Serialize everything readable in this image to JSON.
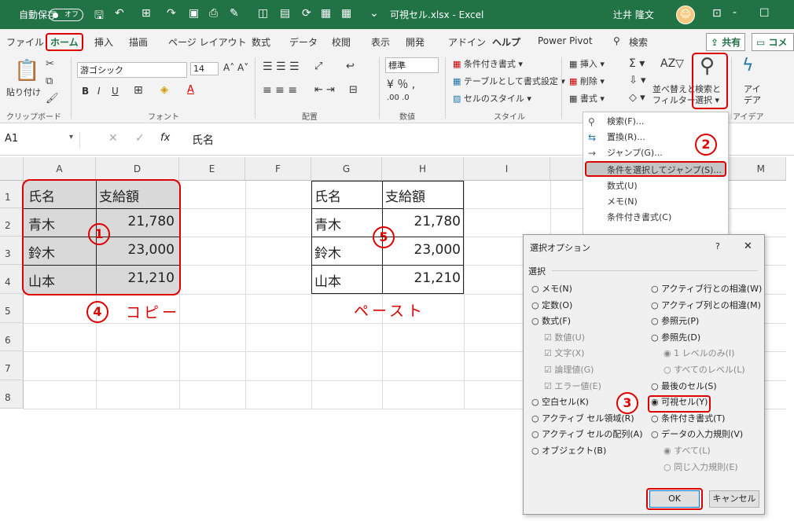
{
  "titlebar": {
    "autosave": "自動保存",
    "toggle": "オフ",
    "filename": "可視セル.xlsx",
    "app": "Excel",
    "user": "辻井 隆文",
    "dash": "-"
  },
  "tabs": [
    "ファイル",
    "ホーム",
    "挿入",
    "描画",
    "ページ レイアウト",
    "数式",
    "データ",
    "校閲",
    "表示",
    "開発",
    "アドイン",
    "ヘルプ",
    "Power Pivot"
  ],
  "search": "検索",
  "share": "共有",
  "comment": "コメ",
  "ribbon": {
    "paste": "貼り付け",
    "clipboard": "クリップボード",
    "font_name": "游ゴシック",
    "font_size": "14",
    "font_group": "フォント",
    "align_group": "配置",
    "num_format": "標準",
    "num_group": "数値",
    "cond_format": "条件付き書式",
    "table_format": "テーブルとして書式設定",
    "cell_style": "セルのスタイル",
    "style_group": "スタイル",
    "insert": "挿入",
    "delete": "削除",
    "format": "書式",
    "sort_filter": [
      "並べ替えと",
      "フィルター"
    ],
    "find_select": [
      "検索と",
      "選択"
    ],
    "ideas": [
      "アイ",
      "デア"
    ],
    "idea_group": "アイデア"
  },
  "formula": {
    "namebox": "A1",
    "fx": "fx",
    "content": "氏名"
  },
  "columns": [
    "A",
    "D",
    "E",
    "F",
    "G",
    "H",
    "I",
    "M"
  ],
  "rows": [
    "1",
    "2",
    "3",
    "4",
    "5",
    "6",
    "7",
    "8"
  ],
  "left_table": {
    "header": [
      "氏名",
      "支給額"
    ],
    "rows": [
      [
        "青木",
        "21,780"
      ],
      [
        "鈴木",
        "23,000"
      ],
      [
        "山本",
        "21,210"
      ]
    ]
  },
  "right_table": {
    "header": [
      "氏名",
      "支給額"
    ],
    "rows": [
      [
        "青木",
        "21,780"
      ],
      [
        "鈴木",
        "23,000"
      ],
      [
        "山本",
        "21,210"
      ]
    ]
  },
  "annotations": {
    "c1": "1",
    "c2": "2",
    "c3": "3",
    "c4": "4",
    "c5": "5",
    "copy": "コピー",
    "paste": "ペースト"
  },
  "menu": [
    {
      "icon": "⚲",
      "label": "検索(F)..."
    },
    {
      "icon": "↔",
      "label": "置換(R)..."
    },
    {
      "icon": "→",
      "label": "ジャンプ(G)..."
    },
    {
      "icon": "",
      "label": "条件を選択してジャンプ(S)..."
    },
    {
      "icon": "",
      "label": "数式(U)"
    },
    {
      "icon": "",
      "label": "メモ(N)"
    },
    {
      "icon": "",
      "label": "条件付き書式(C)"
    }
  ],
  "dialog": {
    "title": "選択オプション",
    "help": "?",
    "close": "✕",
    "section": "選択",
    "left": [
      {
        "label": "メモ(N)",
        "dis": false,
        "type": "radio",
        "checked": false
      },
      {
        "label": "定数(O)",
        "dis": false,
        "type": "radio",
        "checked": false
      },
      {
        "label": "数式(F)",
        "dis": false,
        "type": "radio",
        "checked": false
      },
      {
        "label": "数値(U)",
        "dis": true,
        "type": "check",
        "checked": true
      },
      {
        "label": "文字(X)",
        "dis": true,
        "type": "check",
        "checked": true
      },
      {
        "label": "論理値(G)",
        "dis": true,
        "type": "check",
        "checked": true
      },
      {
        "label": "エラー値(E)",
        "dis": true,
        "type": "check",
        "checked": true
      },
      {
        "label": "空白セル(K)",
        "dis": false,
        "type": "radio",
        "checked": false
      },
      {
        "label": "アクティブ セル領域(R)",
        "dis": false,
        "type": "radio",
        "checked": false
      },
      {
        "label": "アクティブ セルの配列(A)",
        "dis": false,
        "type": "radio",
        "checked": false
      },
      {
        "label": "オブジェクト(B)",
        "dis": false,
        "type": "radio",
        "checked": false
      }
    ],
    "right": [
      {
        "label": "アクティブ行との相違(W)",
        "dis": false,
        "type": "radio",
        "checked": false
      },
      {
        "label": "アクティブ列との相違(M)",
        "dis": false,
        "type": "radio",
        "checked": false
      },
      {
        "label": "参照元(P)",
        "dis": false,
        "type": "radio",
        "checked": false
      },
      {
        "label": "参照先(D)",
        "dis": false,
        "type": "radio",
        "checked": false
      },
      {
        "label": "1 レベルのみ(I)",
        "dis": true,
        "type": "radio",
        "checked": true
      },
      {
        "label": "すべてのレベル(L)",
        "dis": true,
        "type": "radio",
        "checked": false
      },
      {
        "label": "最後のセル(S)",
        "dis": false,
        "type": "radio",
        "checked": false
      },
      {
        "label": "可視セル(Y)",
        "dis": false,
        "type": "radio",
        "checked": true
      },
      {
        "label": "条件付き書式(T)",
        "dis": false,
        "type": "radio",
        "checked": false
      },
      {
        "label": "データの入力規則(V)",
        "dis": false,
        "type": "radio",
        "checked": false
      },
      {
        "label": "すべて(L)",
        "dis": true,
        "type": "radio",
        "checked": true
      },
      {
        "label": "同じ入力規則(E)",
        "dis": true,
        "type": "radio",
        "checked": false
      }
    ],
    "ok": "OK",
    "cancel": "キャンセル"
  }
}
